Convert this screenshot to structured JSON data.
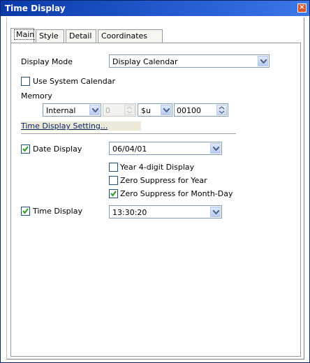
{
  "window": {
    "title": "Time Display"
  },
  "tabs": [
    "Main",
    "Style",
    "Detail",
    "Coordinates"
  ],
  "display_mode": {
    "label": "Display Mode",
    "value": "Display Calendar"
  },
  "use_system_calendar": {
    "label": "Use System Calendar",
    "checked": false
  },
  "memory": {
    "label": "Memory",
    "type": "Internal",
    "index": "0",
    "device": "$u",
    "address": "00100"
  },
  "time_display_setting": {
    "label": "Time Display Setting..."
  },
  "date_display": {
    "label": "Date Display",
    "checked": true,
    "value": "06/04/01"
  },
  "options": [
    {
      "label": "Year 4-digit Display",
      "checked": false
    },
    {
      "label": "Zero Suppress for Year",
      "checked": false
    },
    {
      "label": "Zero Suppress for Month-Day",
      "checked": true
    }
  ],
  "time_display": {
    "label": "Time Display",
    "checked": true,
    "value": "13:30:20"
  },
  "colors": {
    "title_bar": "#0a3aa8",
    "close": "#d9532c",
    "border": "#7f9db9"
  }
}
